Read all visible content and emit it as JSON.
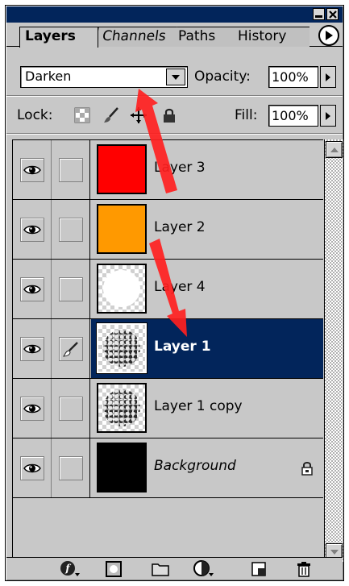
{
  "tabs": [
    {
      "label": "Layers",
      "active": true
    },
    {
      "label": "Channels",
      "active": false
    },
    {
      "label": "Paths",
      "active": false
    },
    {
      "label": "History",
      "active": false
    }
  ],
  "blend_mode": {
    "selected": "Darken"
  },
  "opacity": {
    "label": "Opacity:",
    "value": "100%"
  },
  "lock": {
    "label": "Lock:",
    "icons": [
      "lock-transparency-icon",
      "lock-paint-icon",
      "lock-move-icon",
      "lock-all-icon"
    ]
  },
  "fill": {
    "label": "Fill:",
    "value": "100%"
  },
  "layers": [
    {
      "name": "Layer 3",
      "visible": true,
      "thumbnail": "solid-red",
      "color": "#ff0000",
      "selected": false
    },
    {
      "name": "Layer 2",
      "visible": true,
      "thumbnail": "solid-orange",
      "color": "#ff9900",
      "selected": false
    },
    {
      "name": "Layer 4",
      "visible": true,
      "thumbnail": "white-circle-transparent",
      "selected": false
    },
    {
      "name": "Layer 1",
      "visible": true,
      "thumbnail": "textured-circle-transparent",
      "selected": true,
      "brush_icon": true
    },
    {
      "name": "Layer 1 copy",
      "visible": true,
      "thumbnail": "textured-circle-transparent",
      "selected": false
    },
    {
      "name": "Background",
      "visible": true,
      "thumbnail": "solid-black",
      "color": "#000000",
      "selected": false,
      "italic": true,
      "locked": true
    }
  ],
  "bottom_icons": [
    "layer-style-icon",
    "layer-mask-icon",
    "layer-set-icon",
    "adjustment-layer-icon",
    "new-layer-icon",
    "trash-icon"
  ],
  "colors": {
    "selection": "#02255b",
    "annotation_arrow": "#ff2020"
  }
}
